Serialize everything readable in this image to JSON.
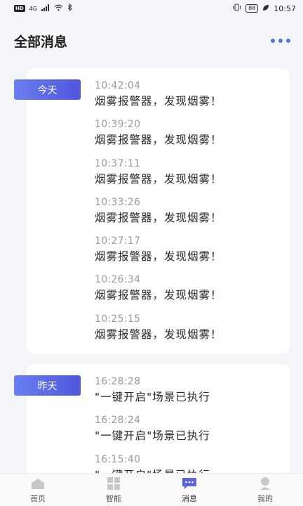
{
  "status_bar": {
    "hd": "HD",
    "net": "4G",
    "battery": "88",
    "time": "10:57"
  },
  "header": {
    "title": "全部消息"
  },
  "groups": [
    {
      "label": "今天",
      "messages": [
        {
          "time": "10:42:04",
          "text": "烟雾报警器，发现烟雾！"
        },
        {
          "time": "10:39:20",
          "text": "烟雾报警器，发现烟雾！"
        },
        {
          "time": "10:37:11",
          "text": "烟雾报警器，发现烟雾！"
        },
        {
          "time": "10:33:26",
          "text": "烟雾报警器，发现烟雾！"
        },
        {
          "time": "10:27:17",
          "text": "烟雾报警器，发现烟雾！"
        },
        {
          "time": "10:26:34",
          "text": "烟雾报警器，发现烟雾！"
        },
        {
          "time": "10:25:15",
          "text": "烟雾报警器，发现烟雾！"
        }
      ]
    },
    {
      "label": "昨天",
      "messages": [
        {
          "time": "16:28:28",
          "text": "\"一键开启\"场景已执行"
        },
        {
          "time": "16:28:24",
          "text": "\"一键开启\"场景已执行"
        },
        {
          "time": "16:15:40",
          "text": "\"一键开启\"场景已执行"
        }
      ]
    }
  ],
  "nav": {
    "items": [
      {
        "label": "首页",
        "icon": "home-icon"
      },
      {
        "label": "智能",
        "icon": "grid-icon"
      },
      {
        "label": "消息",
        "icon": "message-icon"
      },
      {
        "label": "我的",
        "icon": "user-icon"
      }
    ],
    "active_index": 2
  },
  "colors": {
    "accent": "#5a63e0",
    "badge_gradient_start": "#6a7ff0",
    "badge_gradient_end": "#4f56dd",
    "active_icon": "#5b67d9",
    "inactive_icon": "#c8c8c8"
  }
}
